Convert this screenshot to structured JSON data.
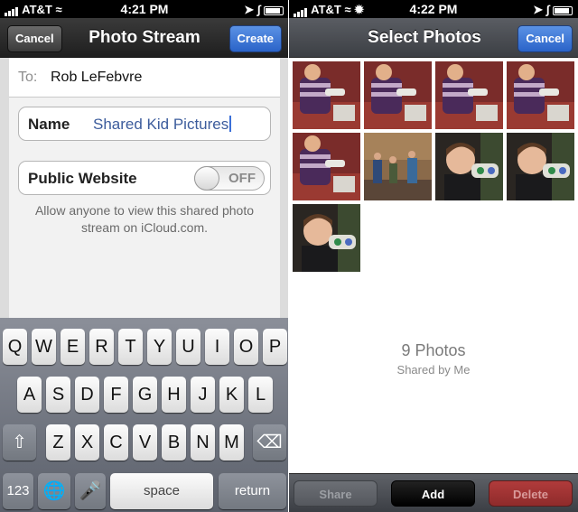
{
  "left_screen": {
    "status_bar": {
      "carrier": "AT&T",
      "time": "4:21 PM"
    },
    "nav": {
      "cancel_label": "Cancel",
      "title": "Photo Stream",
      "create_label": "Create"
    },
    "form": {
      "to_label": "To:",
      "to_value": "Rob LeFebvre",
      "name_label": "Name",
      "name_value": "Shared Kid Pictures",
      "public_label": "Public Website",
      "public_toggle": "OFF",
      "public_caption": "Allow anyone to view this shared photo stream on iCloud.com."
    },
    "keyboard": {
      "row1": [
        "Q",
        "W",
        "E",
        "R",
        "T",
        "Y",
        "U",
        "I",
        "O",
        "P"
      ],
      "row2": [
        "A",
        "S",
        "D",
        "F",
        "G",
        "H",
        "J",
        "K",
        "L"
      ],
      "row3": [
        "Z",
        "X",
        "C",
        "V",
        "B",
        "N",
        "M"
      ],
      "numbers_label": "123",
      "space_label": "space",
      "return_label": "return"
    }
  },
  "right_screen": {
    "status_bar": {
      "carrier": "AT&T",
      "time": "4:22 PM"
    },
    "nav": {
      "title": "Select Photos",
      "cancel_label": "Cancel"
    },
    "photos": [
      {
        "icon": "kids-playing-photo"
      },
      {
        "icon": "kids-playing-photo"
      },
      {
        "icon": "kids-playing-photo"
      },
      {
        "icon": "kids-playing-photo"
      },
      {
        "icon": "kids-playing-photo"
      },
      {
        "icon": "room-group-photo"
      },
      {
        "icon": "boy-portrait-photo"
      },
      {
        "icon": "boy-portrait-photo"
      },
      {
        "icon": "boy-portrait-photo"
      }
    ],
    "photo_count": "9 Photos",
    "shared_by": "Shared by Me",
    "toolbar": {
      "share_label": "Share",
      "add_label": "Add",
      "delete_label": "Delete"
    }
  },
  "colors": {
    "nav_blue_button": "#2a63c8",
    "delete_red": "#8f2b2b",
    "name_text_blue": "#3c5c9c"
  }
}
